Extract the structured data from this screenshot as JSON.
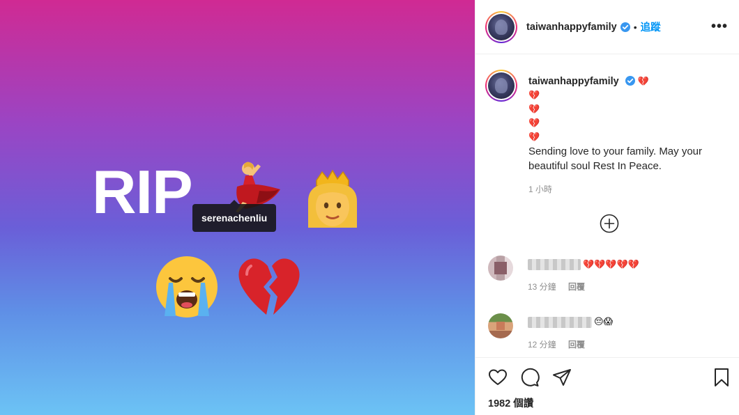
{
  "post": {
    "image_text": "RIP",
    "tagged_user": "serenachenliu",
    "emojis": {
      "dancer": "💃",
      "princess": "👸",
      "crying": "😭",
      "broken_heart": "💔"
    }
  },
  "header": {
    "username": "taiwanhappyfamily",
    "separator": "•",
    "follow_label": "追蹤",
    "more_label": "•••"
  },
  "caption": {
    "username": "taiwanhappyfamily",
    "hearts": [
      "💔",
      "💔",
      "💔",
      "💔",
      "💔"
    ],
    "body": "Sending love to your family. May your beautiful soul Rest In Peace.",
    "time": "1 小時"
  },
  "comments": [
    {
      "text": "💔💔💔💔💔",
      "time": "13 分鐘",
      "reply": "回覆"
    },
    {
      "text": "😔😱",
      "time": "12 分鐘",
      "reply": "回覆"
    }
  ],
  "footer": {
    "views": "1982 個讚"
  },
  "colors": {
    "accent": "#0095f6",
    "gradient_top": "#d02a93",
    "gradient_bottom": "#6cc3f5"
  }
}
